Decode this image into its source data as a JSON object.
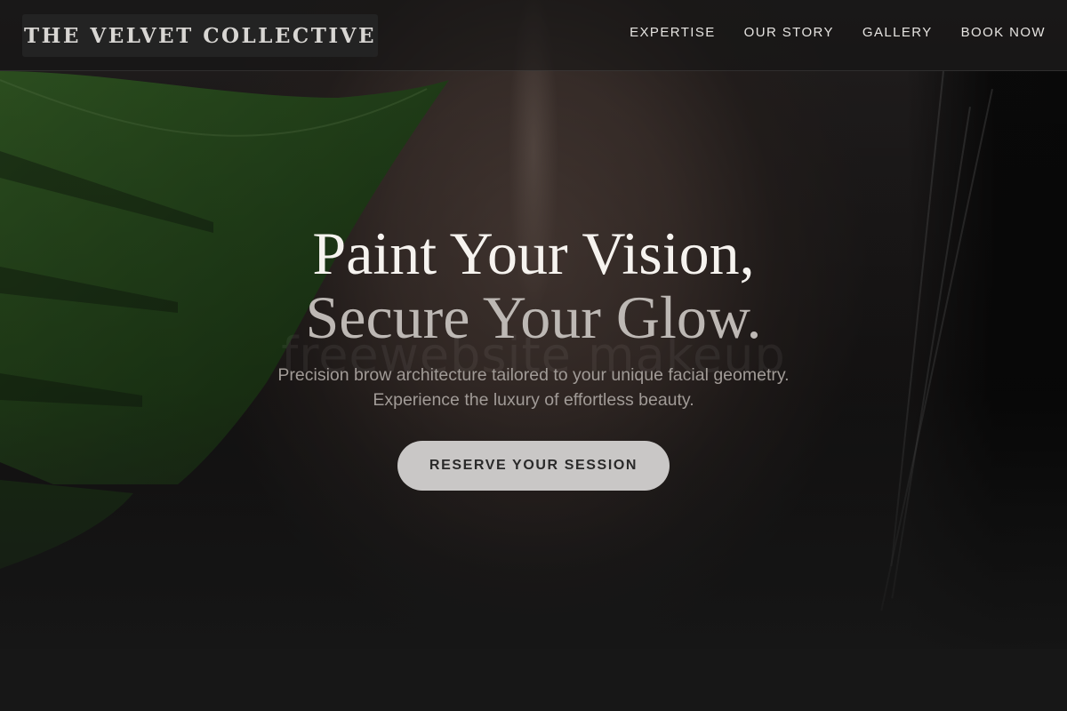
{
  "header": {
    "brand": "THE VELVET COLLECTIVE",
    "nav": [
      {
        "label": "EXPERTISE"
      },
      {
        "label": "OUR STORY"
      },
      {
        "label": "GALLERY"
      },
      {
        "label": "BOOK NOW"
      }
    ]
  },
  "hero": {
    "headline_line1": "Paint Your Vision,",
    "headline_line2": "Secure Your Glow.",
    "watermark": "freewebsite makeup",
    "subtitle_line1": "Precision brow architecture tailored to your unique facial geometry.",
    "subtitle_line2": "Experience the luxury of effortless beauty.",
    "cta_label": "RESERVE YOUR SESSION"
  },
  "colors": {
    "background": "#161616",
    "headline_primary": "#f6f3ef",
    "headline_secondary": "#bdb8b4",
    "subtitle": "#a19b97",
    "cta_background": "#c9c7c6",
    "leaf_green": "#2f5a22"
  }
}
